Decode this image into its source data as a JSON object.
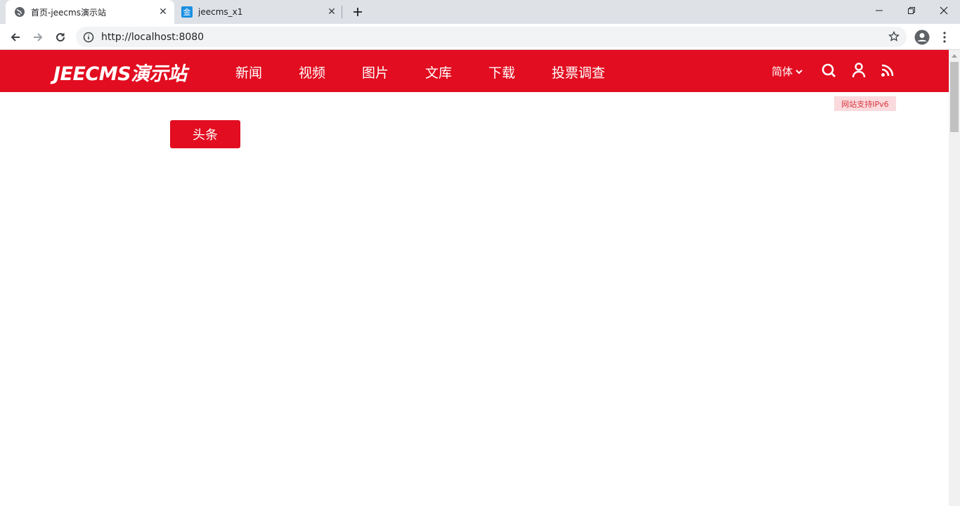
{
  "browser": {
    "tabs": [
      {
        "title": "首页-jeecms演示站",
        "icon": "globe-icon",
        "active": true
      },
      {
        "title": "jeecms_x1",
        "icon": "jin-favicon",
        "favicon_text": "金",
        "active": false
      }
    ],
    "url": "http://localhost:8080"
  },
  "site": {
    "logo": "JEECMS演示站",
    "nav": [
      "新闻",
      "视频",
      "图片",
      "文库",
      "下载",
      "投票调查"
    ],
    "language": "简体",
    "ipv6_badge": "网站支持IPv6",
    "headline_button": "头条"
  },
  "colors": {
    "brand_red": "#e20d20",
    "ipv6_bg": "#fadadd",
    "ipv6_text": "#d8373e"
  }
}
